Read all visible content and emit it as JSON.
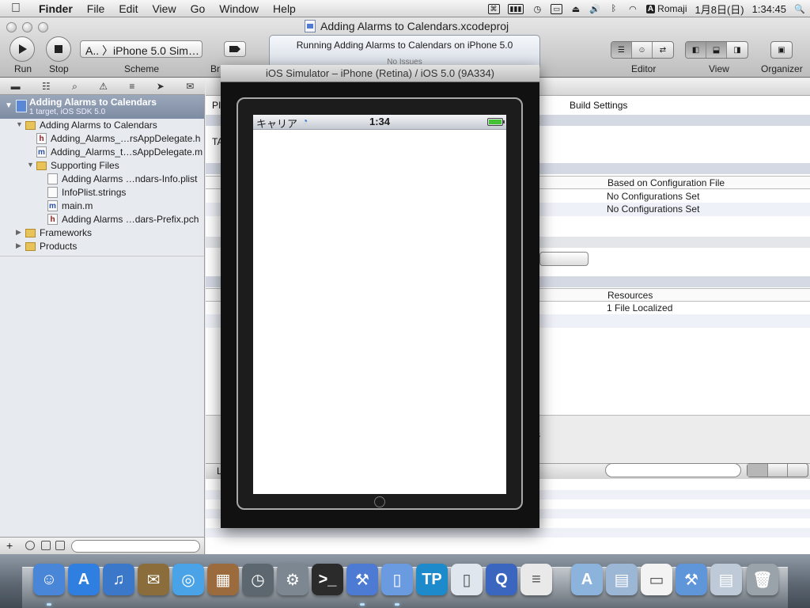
{
  "menubar": {
    "apple": "",
    "app_name": "Finder",
    "menus": [
      "File",
      "Edit",
      "View",
      "Go",
      "Window",
      "Help"
    ],
    "input_mode": "Romaji",
    "input_badge": "A",
    "date": "1月8日(日)",
    "time": "1:34:45"
  },
  "xcode": {
    "window_title": "Adding Alarms to Calendars.xcodeproj",
    "toolbar": {
      "run_label": "Run",
      "stop_label": "Stop",
      "scheme_value": "A.. 〉iPhone 5.0 Sim…",
      "scheme_label": "Scheme",
      "breakpoints_label_partial": "Br",
      "editor_label": "Editor",
      "view_label": "View",
      "organizer_label": "Organizer"
    },
    "activity": {
      "status": "Running Adding Alarms to Calendars on iPhone 5.0",
      "issues": "No Issues"
    },
    "navigator": {
      "project_name": "Adding Alarms to Calendars",
      "project_sub": "1 target, iOS SDK 5.0",
      "items": [
        {
          "label": "Adding Alarms to Calendars",
          "type": "folder",
          "level": 1,
          "expanded": true
        },
        {
          "label": "Adding_Alarms_…rsAppDelegate.h",
          "type": "h",
          "level": 2
        },
        {
          "label": "Adding_Alarms_t…sAppDelegate.m",
          "type": "m",
          "level": 2
        },
        {
          "label": "Supporting Files",
          "type": "folder",
          "level": 2,
          "expanded": true
        },
        {
          "label": "Adding Alarms …ndars-Info.plist",
          "type": "plist",
          "level": 3
        },
        {
          "label": "InfoPlist.strings",
          "type": "strings",
          "level": 3
        },
        {
          "label": "main.m",
          "type": "m",
          "level": 3
        },
        {
          "label": "Adding Alarms …dars-Prefix.pch",
          "type": "h",
          "level": 3
        },
        {
          "label": "Frameworks",
          "type": "folder",
          "level": 1,
          "expanded": false
        },
        {
          "label": "Products",
          "type": "folder",
          "level": 1,
          "expanded": false
        }
      ]
    },
    "editor": {
      "tab_partial": "PI",
      "section_partial": "TA",
      "build_settings_tab": "Build Settings",
      "config_header": "Based on Configuration File",
      "config_rows": [
        "No Configurations Set",
        "No Configurations Set"
      ],
      "resources_header": "Resources",
      "resources_row": "1 File Localized",
      "partial_s": "s",
      "log_partial": "L"
    }
  },
  "simulator": {
    "window_title": "iOS Simulator – iPhone (Retina) / iOS 5.0 (9A334)",
    "carrier": "キャリア",
    "clock": "1:34"
  },
  "dock": {
    "apps": [
      "Finder",
      "App Store",
      "iTunes",
      "Mail",
      "Safari",
      "iPhoto",
      "Time Machine",
      "System Preferences",
      "Terminal",
      "Xcode",
      "iOS Simulator",
      "TexturePacker",
      "iPhone Configuration",
      "QuickTime",
      "Database",
      "Applications",
      "Documents",
      "Document",
      "Xcode Stack",
      "Preview",
      "Trash"
    ]
  }
}
